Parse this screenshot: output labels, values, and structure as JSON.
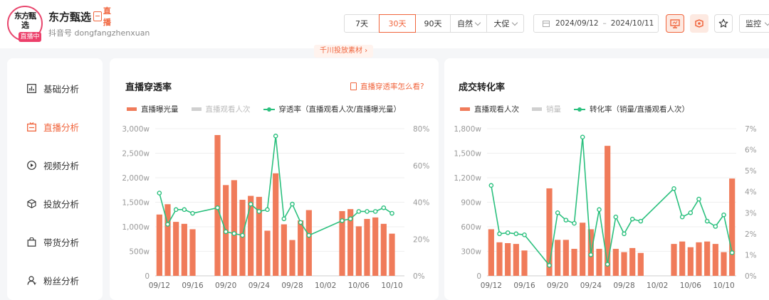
{
  "header": {
    "avatar_top": "东方甄选",
    "live_badge": "直播中",
    "account_name": "东方甄选",
    "platform_tag": "直播",
    "douyin_id": "抖音号 dongfangzhenxuan",
    "range_tabs": [
      "7天",
      "30天",
      "90天"
    ],
    "dropdowns": [
      "自然",
      "大促"
    ],
    "date_start": "2024/09/12",
    "date_sep": "–",
    "date_end": "2024/10/11",
    "monitor": "监控",
    "promo_link": "千川投放素材 ›"
  },
  "sidebar": {
    "items": [
      {
        "label": "基础分析"
      },
      {
        "label": "直播分析"
      },
      {
        "label": "视频分析"
      },
      {
        "label": "投放分析"
      },
      {
        "label": "带货分析"
      },
      {
        "label": "粉丝分析"
      }
    ]
  },
  "panels": [
    {
      "title": "直播穿透率",
      "help": "直播穿透率怎么看?",
      "legend": [
        "直播曝光量",
        "直播观看人次",
        "穿透率（直播观看人次/直播曝光量）"
      ]
    },
    {
      "title": "成交转化率",
      "legend": [
        "直播观看人次",
        "销量",
        "转化率（销量/直播观看人次）"
      ]
    }
  ],
  "colors": {
    "bar": "#F07B5A",
    "line": "#2BC07E",
    "accent": "#F0643C",
    "disabled": "#C8C8C8"
  },
  "chart_data": [
    {
      "type": "bar+line",
      "title": "直播穿透率",
      "x": [
        "09/12",
        "09/13",
        "09/14",
        "09/15",
        "09/16",
        "09/17",
        "09/18",
        "09/19",
        "09/20",
        "09/21",
        "09/22",
        "09/23",
        "09/24",
        "09/25",
        "09/26",
        "09/27",
        "09/28",
        "09/29",
        "09/30",
        "10/01",
        "10/02",
        "10/03",
        "10/04",
        "10/05",
        "10/06",
        "10/07",
        "10/08",
        "10/09",
        "10/10",
        "10/11"
      ],
      "xticks": [
        "09/12",
        "09/16",
        "09/20",
        "09/24",
        "09/28",
        "10/02",
        "10/06",
        "10/10"
      ],
      "yticks_left": [
        "0",
        "500w",
        "1,000w",
        "1,500w",
        "2,000w",
        "2,500w",
        "3,000w"
      ],
      "yticks_right": [
        "0%",
        "20%",
        "40%",
        "60%",
        "80%"
      ],
      "ylim_left": [
        0,
        3000
      ],
      "ylim_right": [
        0,
        80
      ],
      "series": [
        {
          "name": "直播曝光量",
          "type": "bar",
          "axis": "left",
          "unit": "w",
          "values": [
            1250,
            1460,
            1100,
            1060,
            950,
            null,
            null,
            2870,
            1850,
            1950,
            1550,
            1630,
            1610,
            920,
            2090,
            1050,
            730,
            1130,
            1340,
            null,
            null,
            null,
            1320,
            1360,
            1010,
            1160,
            1190,
            1060,
            860,
            null
          ]
        },
        {
          "name": "直播观看人次",
          "type": "bar",
          "axis": "left",
          "disabled": true,
          "values": []
        },
        {
          "name": "穿透率（直播观看人次/直播曝光量）",
          "type": "line",
          "axis": "right",
          "unit": "%",
          "values": [
            45,
            28,
            36,
            36,
            34,
            null,
            null,
            37,
            24,
            23,
            22,
            39,
            35,
            36,
            76,
            31,
            39,
            29,
            22,
            null,
            null,
            null,
            30,
            31,
            35,
            35,
            35,
            37,
            34,
            null
          ]
        }
      ]
    },
    {
      "type": "bar+line",
      "title": "成交转化率",
      "x": [
        "09/12",
        "09/13",
        "09/14",
        "09/15",
        "09/16",
        "09/17",
        "09/18",
        "09/19",
        "09/20",
        "09/21",
        "09/22",
        "09/23",
        "09/24",
        "09/25",
        "09/26",
        "09/27",
        "09/28",
        "09/29",
        "09/30",
        "10/01",
        "10/02",
        "10/03",
        "10/04",
        "10/05",
        "10/06",
        "10/07",
        "10/08",
        "10/09",
        "10/10",
        "10/11"
      ],
      "xticks": [
        "09/12",
        "09/16",
        "09/20",
        "09/24",
        "09/28",
        "10/02",
        "10/06",
        "10/10"
      ],
      "yticks_left": [
        "0",
        "300w",
        "600w",
        "900w",
        "1,200w",
        "1,500w",
        "1,800w"
      ],
      "yticks_right": [
        "0%",
        "1%",
        "2%",
        "3%",
        "4%",
        "5%",
        "6%",
        "7%"
      ],
      "ylim_left": [
        0,
        1800
      ],
      "ylim_right": [
        0,
        7
      ],
      "series": [
        {
          "name": "直播观看人次",
          "type": "bar",
          "axis": "left",
          "unit": "w",
          "values": [
            570,
            410,
            400,
            390,
            310,
            null,
            null,
            1070,
            440,
            440,
            330,
            650,
            570,
            330,
            1590,
            330,
            290,
            340,
            280,
            null,
            null,
            null,
            390,
            420,
            350,
            410,
            420,
            390,
            290,
            1190
          ]
        },
        {
          "name": "销量",
          "type": "bar",
          "axis": "left",
          "disabled": true,
          "values": []
        },
        {
          "name": "转化率（销量/直播观看人次）",
          "type": "line",
          "axis": "right",
          "unit": "%",
          "values": [
            4.3,
            2.0,
            2.05,
            2.0,
            1.95,
            null,
            null,
            0.5,
            3.0,
            2.65,
            2.5,
            6.6,
            1.0,
            3.15,
            0.55,
            2.8,
            2.0,
            2.7,
            2.6,
            null,
            null,
            null,
            4.15,
            2.8,
            3.0,
            3.65,
            2.6,
            2.35,
            2.9,
            1.1
          ]
        }
      ]
    }
  ]
}
